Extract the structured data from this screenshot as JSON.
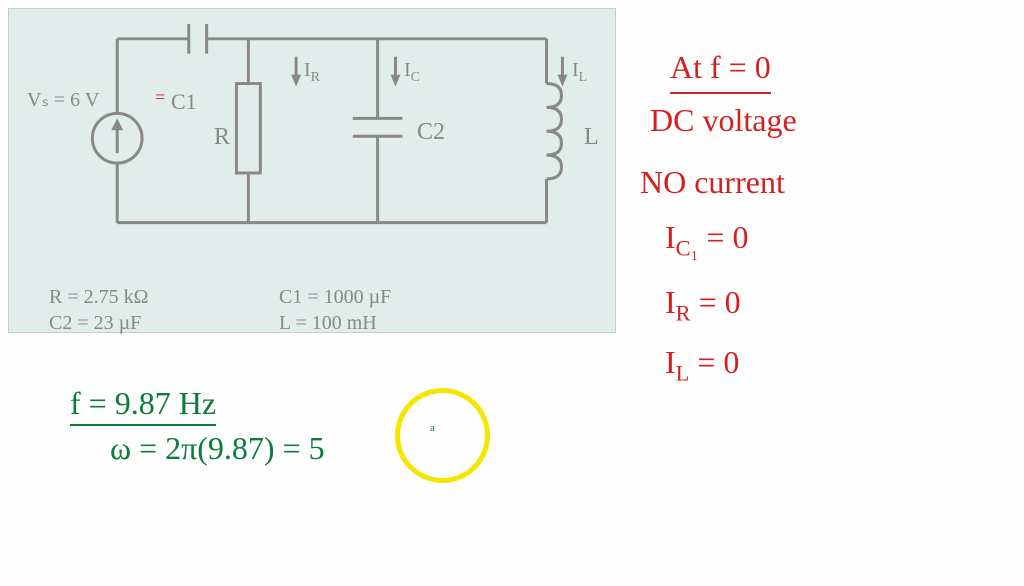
{
  "circuit": {
    "vs_label": "Vₛ = 6 V",
    "c1_annotation": "=",
    "c1_label": "C1",
    "ir_label": "I",
    "ir_sub": "R",
    "ic_label": "I",
    "ic_sub": "C",
    "il_label": "I",
    "il_sub": "L",
    "r_label": "R",
    "c2_label": "C2",
    "l_label": "L"
  },
  "params": {
    "r": "R = 2.75 kΩ",
    "c2": "C2 = 23 µF",
    "c1": "C1 = 1000 µF",
    "l": "L = 100 mH"
  },
  "notes_red": {
    "line1": "At  f = 0",
    "line2": "DC voltage",
    "line3": "NO current",
    "line4_pre": "I",
    "line4_sub": "C₁",
    "line4_post": " = 0",
    "line5_pre": "I",
    "line5_sub": "R",
    "line5_post": "  = 0",
    "line6_pre": "I",
    "line6_sub": "L",
    "line6_post": " = 0"
  },
  "notes_green": {
    "line1": "f = 9.87 Hz",
    "line2": "ω = 2π(9.87) = 5"
  },
  "calc_partial": "ᵃ"
}
